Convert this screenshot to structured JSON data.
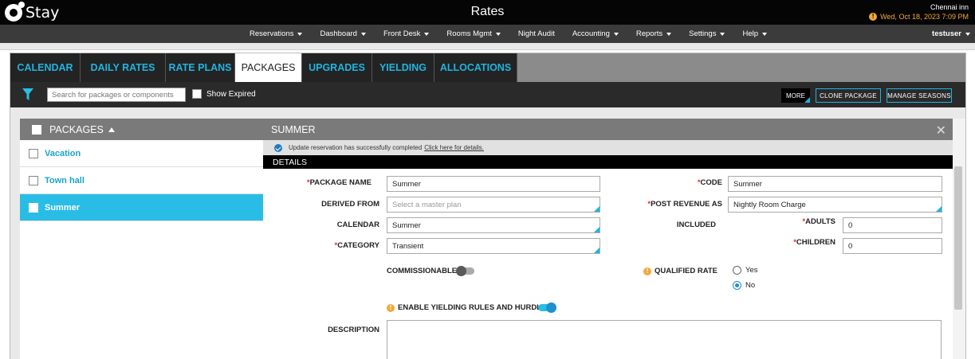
{
  "topbar": {
    "logo_text": "Stay",
    "title": "Rates",
    "hotel_name": "Chennai inn",
    "datetime": "Wed, Oct 18, 2023 7:09 PM"
  },
  "nav": {
    "items": [
      {
        "label": "Reservations",
        "dropdown": true
      },
      {
        "label": "Dashboard",
        "dropdown": true
      },
      {
        "label": "Front Desk",
        "dropdown": true
      },
      {
        "label": "Rooms Mgmt",
        "dropdown": true
      },
      {
        "label": "Night Audit",
        "dropdown": false
      },
      {
        "label": "Accounting",
        "dropdown": true
      },
      {
        "label": "Reports",
        "dropdown": true
      },
      {
        "label": "Settings",
        "dropdown": true
      },
      {
        "label": "Help",
        "dropdown": true
      }
    ],
    "user": "testuser"
  },
  "tabs": [
    {
      "label": "CALENDAR",
      "active": false
    },
    {
      "label": "DAILY RATES",
      "active": false
    },
    {
      "label": "RATE PLANS",
      "active": false
    },
    {
      "label": "PACKAGES",
      "active": true
    },
    {
      "label": "UPGRADES",
      "active": false
    },
    {
      "label": "YIELDING",
      "active": false
    },
    {
      "label": "ALLOCATIONS",
      "active": false
    }
  ],
  "toolbar": {
    "search_placeholder": "Search for packages or components",
    "show_expired": "Show Expired",
    "more": "MORE",
    "clone": "CLONE PACKAGE",
    "manage": "MANAGE SEASONS"
  },
  "packages": {
    "header": "PACKAGES",
    "items": [
      "Vacation",
      "Town hall",
      "Summer"
    ],
    "selected": "Summer"
  },
  "detail": {
    "title": "SUMMER",
    "notice": "Update reservation has successfully completed",
    "notice_link": "Click here for details.",
    "section": "DETAILS",
    "package_name_label": "PACKAGE NAME",
    "package_name": "Summer",
    "derived_from_label": "DERIVED FROM",
    "derived_from_placeholder": "Select a master plan",
    "calendar_label": "CALENDAR",
    "calendar": "Summer",
    "category_label": "CATEGORY",
    "category": "Transient",
    "commissionable_label": "COMMISSIONABLE",
    "yielding_label": "ENABLE YIELDING RULES AND HURDLES",
    "description_label": "DESCRIPTION",
    "code_label": "CODE",
    "code": "Summer",
    "post_revenue_label": "POST REVENUE AS",
    "post_revenue": "Nightly Room Charge",
    "included_label": "INCLUDED",
    "adults_label": "ADULTS",
    "adults": "0",
    "children_label": "CHILDREN",
    "children": "0",
    "qualified_label": "QUALIFIED RATE",
    "yes": "Yes",
    "no": "No",
    "required_mark": "*",
    "info_glyph": "!"
  }
}
